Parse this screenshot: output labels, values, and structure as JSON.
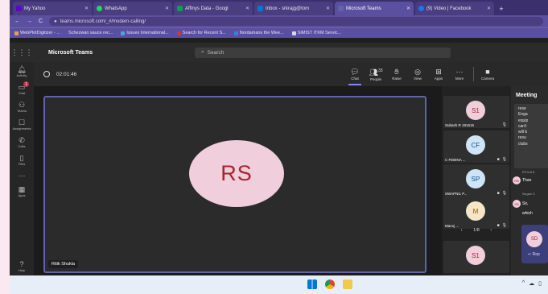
{
  "browser": {
    "tabs": [
      {
        "label": "My Yahoo",
        "color": "#6001d2"
      },
      {
        "label": "WhatsApp",
        "color": "#25d366"
      },
      {
        "label": "Affinys Data - Googl",
        "color": "#0f9d58"
      },
      {
        "label": "Inbox - srkrajg@tom",
        "color": "#0078d4"
      },
      {
        "label": "Microsoft Teams",
        "color": "#6264a7",
        "active": true
      },
      {
        "label": "(9) Video | Facebook",
        "color": "#1877f2"
      }
    ],
    "url": "teams.microsoft.com/_#/modern-calling/",
    "bookmarks": [
      "WebPlotDigitizer - ...",
      "Schezwan sauce rec...",
      "Issues International...",
      "Search for Recent S...",
      "Nordamans the Wee...",
      "SIMIST ITKM Servic..."
    ]
  },
  "teams": {
    "app_title": "Microsoft Teams",
    "search_placeholder": "Search"
  },
  "rail": [
    {
      "label": "Activity",
      "icon": "bell-icon"
    },
    {
      "label": "Chat",
      "icon": "chat-icon",
      "badge": "1"
    },
    {
      "label": "Teams",
      "icon": "teams-icon"
    },
    {
      "label": "Assignments",
      "icon": "assignments-icon"
    },
    {
      "label": "Calls",
      "icon": "phone-icon"
    },
    {
      "label": "Files",
      "icon": "files-icon"
    },
    {
      "label": "",
      "icon": "more-icon"
    },
    {
      "label": "Apps",
      "icon": "apps-icon"
    }
  ],
  "rail_help": "Help",
  "meeting": {
    "timer": "02:01:46",
    "tools": [
      {
        "label": "Chat",
        "icon": "chat-icon",
        "active": true
      },
      {
        "label": "People",
        "icon": "people-icon",
        "count": "33"
      },
      {
        "label": "Raise",
        "icon": "hand-icon"
      },
      {
        "label": "View",
        "icon": "view-icon"
      },
      {
        "label": "Apps",
        "icon": "apps-icon"
      },
      {
        "label": "More",
        "icon": "more-icon"
      }
    ],
    "camera_label": "Camera"
  },
  "main_video": {
    "initials": "RS",
    "name": "Ritik Shukla"
  },
  "participants": [
    {
      "initials": "S1",
      "name": "Subash R 181616",
      "bg": "#f0cedb",
      "fg": "#a4262c"
    },
    {
      "initials": "CF",
      "name": "C FEBINA ...",
      "bg": "#cfe4f6",
      "fg": "#0f548c"
    },
    {
      "initials": "SP",
      "name": "SWAPNIL P...",
      "bg": "#cfe4f6",
      "fg": "#0f548c"
    },
    {
      "initials": "M",
      "name": "Manoj ...",
      "bg": "#f6e6c8",
      "fg": "#8a5a00"
    },
    {
      "initials": "S1",
      "name": "",
      "bg": "#f0cedb",
      "fg": "#a4262c"
    }
  ],
  "pager": "1/8",
  "chat": {
    "title": "Meeting",
    "message_lines": [
      "rese",
      "Enga",
      "equip",
      "can't",
      "will b",
      "resu",
      "clubs"
    ],
    "messages": [
      {
        "meta": "RITUJA B",
        "initials": "RB",
        "text": "Than",
        "bg": "#f0cedb",
        "fg": "#a4262c"
      },
      {
        "meta": "Sargam S",
        "initials": "SD",
        "text": "Sir,",
        "bg": "#f0cedb",
        "fg": "#a4262c"
      },
      {
        "meta": "",
        "initials": "",
        "text": "which",
        "bg": "",
        "fg": ""
      }
    ],
    "reply_avatar": "SD",
    "reply_label": "Rep"
  }
}
